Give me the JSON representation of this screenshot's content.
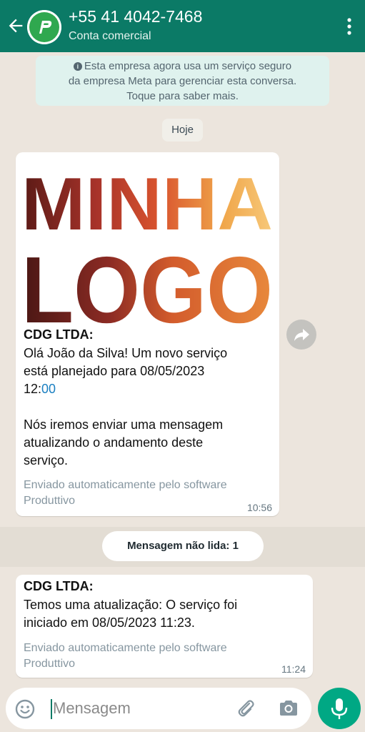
{
  "header": {
    "contact_name": "+55 41 4042-7468",
    "subtitle": "Conta comercial",
    "accent_color": "#0b7a66"
  },
  "info_banner": {
    "line1": "Esta empresa agora usa um serviço seguro",
    "line2": "da empresa Meta para gerenciar esta conversa.",
    "line3": "Toque para saber mais."
  },
  "date_label": "Hoje",
  "logo": {
    "line1": "MINHA",
    "line2": "LOGO"
  },
  "messages": [
    {
      "sender": "CDG LTDA:",
      "text_line1": "Olá João da Silva! Um novo serviço",
      "text_line2": "está planejado para 08/05/2023",
      "time_hour": "12:",
      "time_minute_link": "00",
      "text_para2_line1": "Nós iremos enviar uma mensagem",
      "text_para2_line2": "atualizando o andamento deste",
      "text_para2_line3": "serviço.",
      "footer_line1": "Enviado automaticamente pelo software",
      "footer_line2": "Produttivo",
      "time": "10:56"
    },
    {
      "sender": "CDG LTDA:",
      "text_line1": "Temos uma atualização: O serviço foi",
      "text_line2": "iniciado em 08/05/2023 11:23.",
      "footer_line1": "Enviado automaticamente pelo software",
      "footer_line2": "Produttivo",
      "time": "11:24"
    }
  ],
  "unread_label": "Mensagem não lida: 1",
  "input": {
    "placeholder": "Mensagem",
    "value": ""
  },
  "icons": {
    "back": "back-arrow-icon",
    "menu": "more-vertical-icon",
    "forward": "forward-icon",
    "emoji": "emoji-icon",
    "attach": "paperclip-icon",
    "camera": "camera-icon",
    "mic": "microphone-icon"
  }
}
